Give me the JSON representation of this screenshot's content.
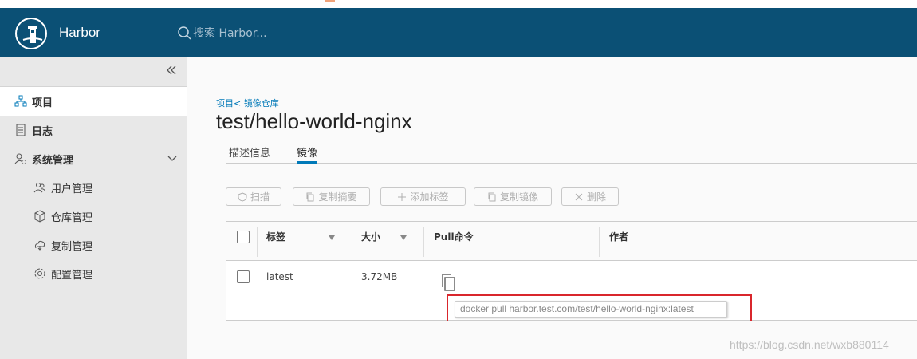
{
  "header": {
    "brand": "Harbor",
    "search_placeholder": "搜索 Harbor..."
  },
  "sidebar": {
    "items": [
      {
        "label": "项目",
        "icon": "project-icon"
      },
      {
        "label": "日志",
        "icon": "log-icon"
      },
      {
        "label": "系统管理",
        "icon": "admin-icon"
      },
      {
        "label": "用户管理",
        "icon": "users-icon"
      },
      {
        "label": "仓库管理",
        "icon": "registry-icon"
      },
      {
        "label": "复制管理",
        "icon": "replication-icon"
      },
      {
        "label": "配置管理",
        "icon": "config-icon"
      }
    ]
  },
  "main": {
    "breadcrumb": "项目< 镜像仓库",
    "title": "test/hello-world-nginx",
    "tabs": [
      "描述信息",
      "镜像"
    ],
    "toolbar": [
      "扫描",
      "复制摘要",
      "添加标签",
      "复制镜像",
      "删除"
    ],
    "columns": [
      "标签",
      "大小",
      "Pull命令",
      "作者"
    ],
    "rows": [
      {
        "tag": "latest",
        "size": "3.72MB",
        "pull": "docker pull harbor.test.com/test/hello-world-nginx:latest",
        "author": ""
      }
    ]
  },
  "watermark": "https://blog.csdn.net/wxb880114",
  "colors": {
    "header": "#0b5075",
    "accent": "#0079b8",
    "highlight": "#d9262c"
  }
}
